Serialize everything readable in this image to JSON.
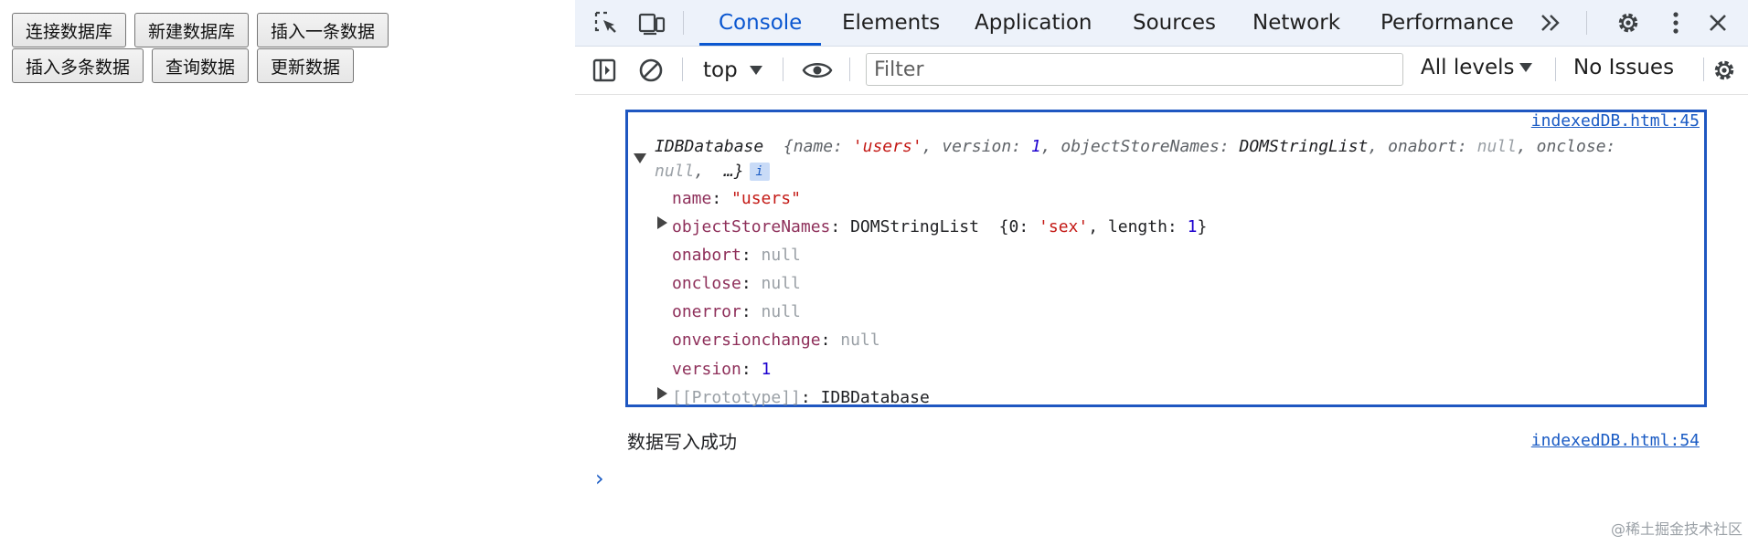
{
  "page": {
    "buttons_row1": [
      "连接数据库",
      "新建数据库",
      "插入一条数据"
    ],
    "buttons_row2": [
      "插入多条数据",
      "查询数据",
      "更新数据"
    ]
  },
  "devtools": {
    "tabs": [
      "Console",
      "Elements",
      "Application",
      "Sources",
      "Network",
      "Performance"
    ],
    "active_tab": "Console",
    "toolbar": {
      "context": "top",
      "filter_placeholder": "Filter",
      "levels": "All levels",
      "issues": "No Issues"
    },
    "icons": {
      "inspect": "inspect-element-icon",
      "device": "device-toolbar-icon",
      "more_tabs": "double-chevron-icon",
      "settings": "gear-icon",
      "menu": "kebab-menu-icon",
      "close": "close-icon",
      "sidebar": "sidebar-toggle-icon",
      "clear": "clear-console-icon",
      "eye": "eye-icon"
    },
    "accent_color": "#0b57d0"
  },
  "console": {
    "entry1": {
      "source": "indexedDB.html:45",
      "summary_type": "IDBDatabase",
      "summary_line1": {
        "open": "{",
        "name_key": "name",
        "name_val": "'users'",
        "version_key": "version",
        "version_val": "1",
        "osn_key": "objectStoreNames",
        "osn_val": "DOMStringList",
        "onabort_key": "onabort",
        "onabort_val": "null",
        "onclose_key": "onclose"
      },
      "summary_line2": {
        "onclose_val": "null",
        "ellipsis": "…}",
        "info": "i"
      },
      "props": {
        "name_key": "name",
        "name_val": "\"users\"",
        "osn_key": "objectStoreNames",
        "osn_type": "DOMStringList",
        "osn_preview_open": "{0: ",
        "osn_preview_val": "'sex'",
        "osn_preview_len_key": "length",
        "osn_preview_len_val": "1",
        "osn_preview_close": "}",
        "onabort_key": "onabort",
        "onabort_val": "null",
        "onclose_key": "onclose",
        "onclose_val": "null",
        "onerror_key": "onerror",
        "onerror_val": "null",
        "onversionchange_key": "onversionchange",
        "onversionchange_val": "null",
        "version_key": "version",
        "version_val": "1",
        "proto_key": "[[Prototype]]",
        "proto_val": "IDBDatabase"
      }
    },
    "entry2": {
      "text": "数据写入成功",
      "source": "indexedDB.html:54"
    },
    "prompt": "›"
  },
  "watermark": "@稀土掘金技术社区"
}
